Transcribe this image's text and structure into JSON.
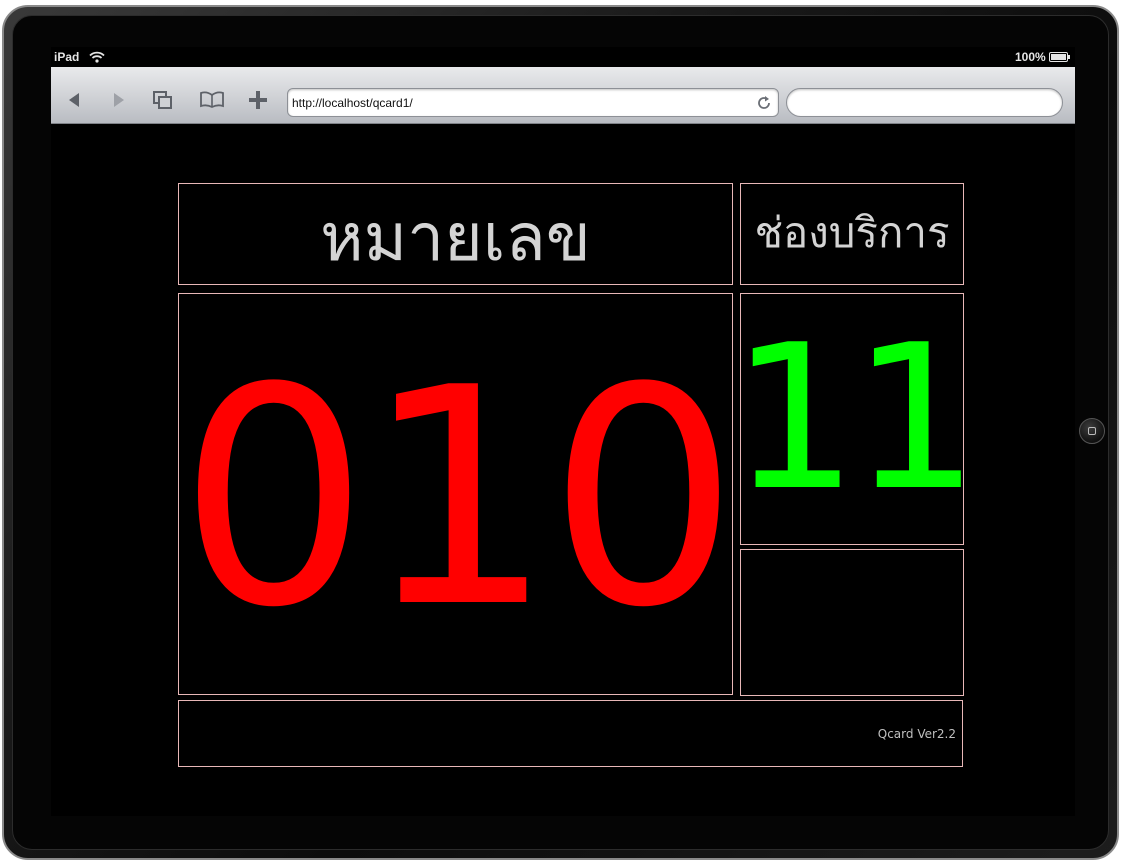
{
  "status_bar": {
    "device": "iPad",
    "battery": "100%"
  },
  "browser": {
    "url": "http://localhost/qcard1/",
    "search_placeholder": ""
  },
  "display": {
    "number_header": "หมายเลข",
    "counter_header": "ช่องบริการ",
    "queue_number": "010",
    "counter_number": "11",
    "version": "Qcard Ver2.2"
  },
  "colors": {
    "queue_number": "#ff0000",
    "counter_number": "#00ff00",
    "header_text": "#d4d4d4",
    "cell_border": "#e8b8b8",
    "background": "#000000"
  }
}
